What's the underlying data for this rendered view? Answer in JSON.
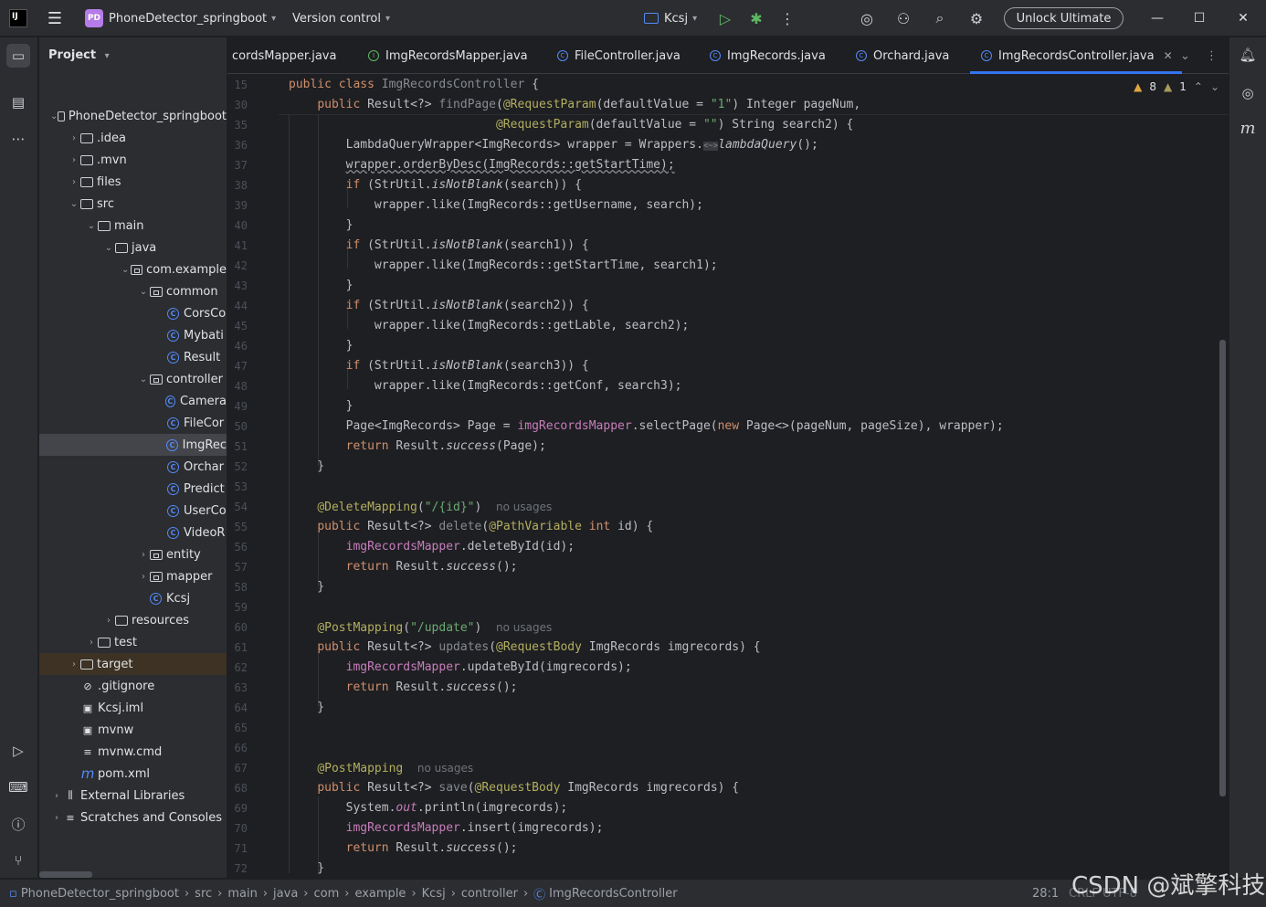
{
  "titlebar": {
    "app_icon": "intellij-icon",
    "project_badge": "PD",
    "project_name": "PhoneDetector_springboot",
    "vcs": "Version control",
    "run_config": "Kcsj",
    "unlock": "Unlock Ultimate"
  },
  "project_panel": {
    "title": "Project",
    "tree": [
      {
        "label": "PhoneDetector_springboot",
        "depth": 0,
        "expanded": true,
        "icon": "module"
      },
      {
        "label": ".idea",
        "depth": 1,
        "expanded": false,
        "icon": "folder"
      },
      {
        "label": ".mvn",
        "depth": 1,
        "expanded": false,
        "icon": "folder"
      },
      {
        "label": "files",
        "depth": 1,
        "expanded": false,
        "icon": "folder"
      },
      {
        "label": "src",
        "depth": 1,
        "expanded": true,
        "icon": "folder"
      },
      {
        "label": "main",
        "depth": 2,
        "expanded": true,
        "icon": "folder"
      },
      {
        "label": "java",
        "depth": 3,
        "expanded": true,
        "icon": "folder"
      },
      {
        "label": "com.example",
        "depth": 4,
        "expanded": true,
        "icon": "package"
      },
      {
        "label": "common",
        "depth": 5,
        "expanded": true,
        "icon": "package"
      },
      {
        "label": "CorsCo",
        "depth": 6,
        "icon": "class"
      },
      {
        "label": "Mybati",
        "depth": 6,
        "icon": "class"
      },
      {
        "label": "Result",
        "depth": 6,
        "icon": "class"
      },
      {
        "label": "controller",
        "depth": 5,
        "expanded": true,
        "icon": "package"
      },
      {
        "label": "Camera",
        "depth": 6,
        "icon": "class"
      },
      {
        "label": "FileCor",
        "depth": 6,
        "icon": "class"
      },
      {
        "label": "ImgRec",
        "depth": 6,
        "icon": "class",
        "selected": true
      },
      {
        "label": "Orchar",
        "depth": 6,
        "icon": "class"
      },
      {
        "label": "Predict",
        "depth": 6,
        "icon": "class"
      },
      {
        "label": "UserCo",
        "depth": 6,
        "icon": "class"
      },
      {
        "label": "VideoR",
        "depth": 6,
        "icon": "class"
      },
      {
        "label": "entity",
        "depth": 5,
        "expanded": false,
        "icon": "package"
      },
      {
        "label": "mapper",
        "depth": 5,
        "expanded": false,
        "icon": "package"
      },
      {
        "label": "Kcsj",
        "depth": 5,
        "icon": "class"
      },
      {
        "label": "resources",
        "depth": 3,
        "expanded": false,
        "icon": "folder"
      },
      {
        "label": "test",
        "depth": 2,
        "expanded": false,
        "icon": "folder"
      },
      {
        "label": "target",
        "depth": 1,
        "expanded": false,
        "icon": "folder",
        "highlight": true
      },
      {
        "label": ".gitignore",
        "depth": 1,
        "icon": "ignore"
      },
      {
        "label": "Kcsj.iml",
        "depth": 1,
        "icon": "file"
      },
      {
        "label": "mvnw",
        "depth": 1,
        "icon": "file"
      },
      {
        "label": "mvnw.cmd",
        "depth": 1,
        "icon": "text"
      },
      {
        "label": "pom.xml",
        "depth": 1,
        "icon": "maven"
      },
      {
        "label": "External Libraries",
        "depth": 0,
        "expanded": false,
        "icon": "library"
      },
      {
        "label": "Scratches and Consoles",
        "depth": 0,
        "expanded": false,
        "icon": "scratch"
      }
    ]
  },
  "tabs": [
    {
      "label": "cordsMapper.java",
      "icon": "interface"
    },
    {
      "label": "ImgRecordsMapper.java",
      "icon": "interface"
    },
    {
      "label": "FileController.java",
      "icon": "class"
    },
    {
      "label": "ImgRecords.java",
      "icon": "class"
    },
    {
      "label": "Orchard.java",
      "icon": "class"
    },
    {
      "label": "ImgRecordsController.java",
      "icon": "class",
      "active": true
    }
  ],
  "inspections": {
    "warnings": "8",
    "weak_warnings": "1"
  },
  "editor": {
    "lines": [
      15,
      30,
      35,
      36,
      37,
      38,
      39,
      40,
      41,
      42,
      43,
      44,
      45,
      46,
      47,
      48,
      49,
      50,
      51,
      52,
      53,
      54,
      55,
      56,
      57,
      58,
      59,
      60,
      61,
      62,
      63,
      64,
      65,
      66,
      67,
      68,
      69,
      70,
      71,
      72
    ]
  },
  "statusbar": {
    "crumbs": [
      "PhoneDetector_springboot",
      "src",
      "main",
      "java",
      "com",
      "example",
      "Kcsj",
      "controller",
      "ImgRecordsController"
    ],
    "position": "28:1",
    "encoding_partial": "CRLF   UTF-8",
    "watermark": "CSDN @斌擎科技"
  }
}
